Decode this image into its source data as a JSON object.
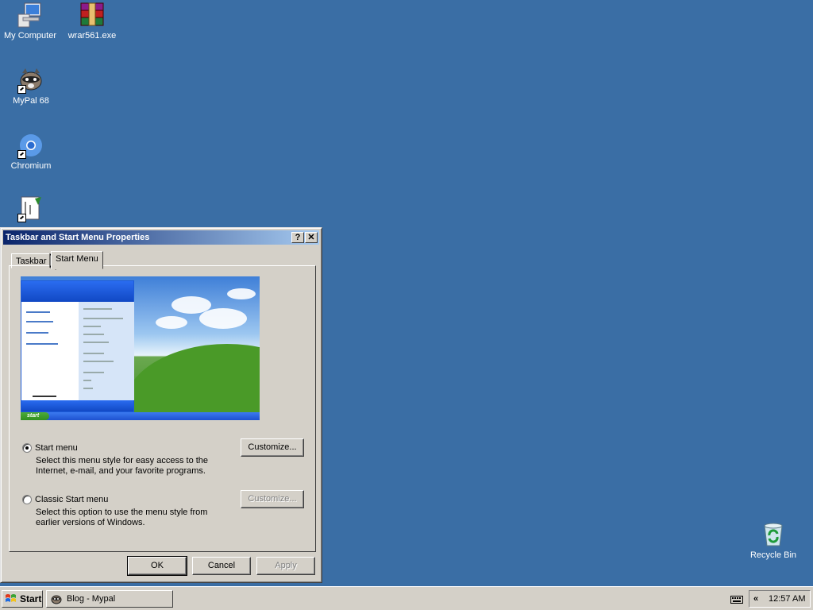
{
  "desktop": {
    "icons": [
      {
        "label": "My Computer",
        "icon": "my-computer-icon"
      },
      {
        "label": "wrar561.exe",
        "icon": "winrar-archive-icon"
      },
      {
        "label": "MyPal 68",
        "icon": "mypal-raccoon-icon"
      },
      {
        "label": "Chromium",
        "icon": "chromium-icon"
      },
      {
        "label": "",
        "icon": "spreadsheet-shortcut-icon"
      },
      {
        "label": "Recycle Bin",
        "icon": "recycle-bin-icon"
      }
    ]
  },
  "dialog": {
    "title": "Taskbar and Start Menu Properties",
    "help_label": "?",
    "close_label": "✕",
    "tabs": [
      {
        "label": "Taskbar"
      },
      {
        "label": "Start Menu",
        "selected": true
      }
    ],
    "options": [
      {
        "label": "Start menu",
        "description_line1": "Select this menu style for easy access to the",
        "description_line2": "Internet, e-mail, and your favorite programs.",
        "selected": true,
        "customize_label": "Customize...",
        "customize_enabled": true
      },
      {
        "label": "Classic Start menu",
        "description_line1": "Select this option to use the menu style from",
        "description_line2": "earlier versions of Windows.",
        "selected": false,
        "customize_label": "Customize...",
        "customize_enabled": false
      }
    ],
    "buttons": {
      "ok": "OK",
      "cancel": "Cancel",
      "apply": "Apply"
    },
    "preview": {
      "start_label": "start"
    }
  },
  "taskbar": {
    "start_label": "Start",
    "task_label": "Blog - Mypal",
    "tray_chevron": "«",
    "clock": "12:57 AM"
  },
  "colors": {
    "desktop": "#3a6ea5",
    "title_active": "#0a246a",
    "face": "#d4d0c8"
  }
}
